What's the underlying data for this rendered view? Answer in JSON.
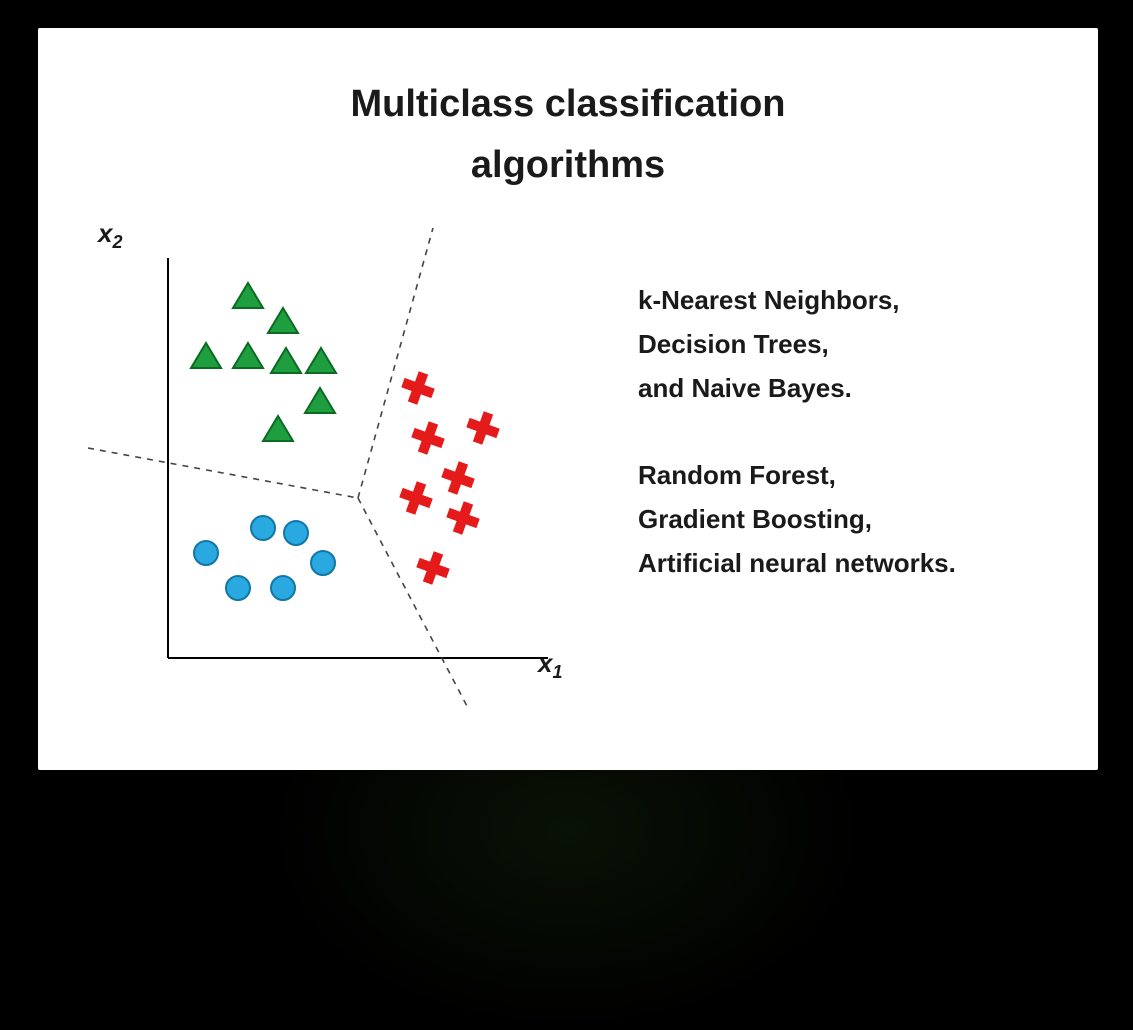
{
  "title_line1": "Multiclass classification",
  "title_line2": "algorithms",
  "axis_y": "x",
  "axis_y_sub": "2",
  "axis_x": "x",
  "axis_x_sub": "1",
  "group1": {
    "line1": "k-Nearest Neighbors,",
    "line2": "Decision Trees,",
    "line3": "and Naive Bayes."
  },
  "group2": {
    "line1": "Random Forest,",
    "line2": "Gradient Boosting,",
    "line3": "Artificial neural networks."
  },
  "chart_data": {
    "type": "scatter",
    "title": "Multiclass classification",
    "xlabel": "x1",
    "ylabel": "x2",
    "axes_visible": true,
    "decision_boundaries": 3,
    "series": [
      {
        "name": "class-triangles",
        "marker": "triangle",
        "color": "#1e9e3e",
        "points": [
          {
            "x": 1.6,
            "y": 7.2
          },
          {
            "x": 2.3,
            "y": 6.6
          },
          {
            "x": 0.8,
            "y": 5.8
          },
          {
            "x": 1.6,
            "y": 5.8
          },
          {
            "x": 2.3,
            "y": 5.7
          },
          {
            "x": 3.0,
            "y": 5.7
          },
          {
            "x": 3.0,
            "y": 4.9
          },
          {
            "x": 2.1,
            "y": 4.4
          }
        ]
      },
      {
        "name": "class-circles",
        "marker": "circle",
        "color": "#2aa8e0",
        "points": [
          {
            "x": 1.9,
            "y": 2.6
          },
          {
            "x": 2.5,
            "y": 2.5
          },
          {
            "x": 0.8,
            "y": 2.1
          },
          {
            "x": 3.1,
            "y": 1.9
          },
          {
            "x": 1.5,
            "y": 1.4
          },
          {
            "x": 2.3,
            "y": 1.4
          }
        ]
      },
      {
        "name": "class-crosses",
        "marker": "cross",
        "color": "#e51a1a",
        "points": [
          {
            "x": 5.0,
            "y": 5.4
          },
          {
            "x": 5.2,
            "y": 4.4
          },
          {
            "x": 6.2,
            "y": 4.6
          },
          {
            "x": 5.7,
            "y": 3.6
          },
          {
            "x": 5.0,
            "y": 3.2
          },
          {
            "x": 5.9,
            "y": 2.9
          },
          {
            "x": 5.3,
            "y": 1.8
          }
        ]
      }
    ]
  }
}
